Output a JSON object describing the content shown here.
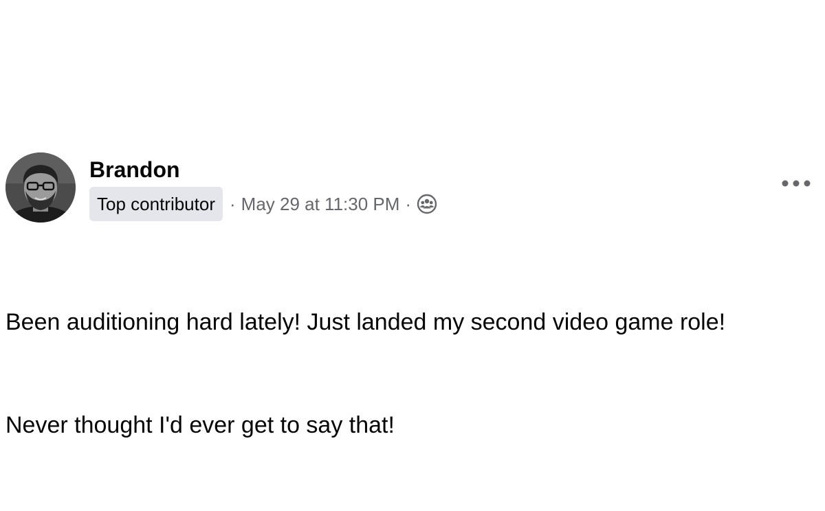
{
  "post": {
    "author": {
      "name": "Brandon",
      "badge": "Top contributor",
      "avatar_icon": "profile-photo"
    },
    "meta": {
      "separator": "·",
      "timestamp": "May 29 at 11:30 PM",
      "audience_icon": "group-members-icon"
    },
    "more_icon": "more-options-icon",
    "body_lines": [
      "Been auditioning hard lately! Just landed my second video game role!",
      "Never thought I'd ever get to say that!"
    ]
  },
  "colors": {
    "text_primary": "#050505",
    "text_secondary": "#65676b",
    "badge_bg": "#e4e6eb"
  }
}
